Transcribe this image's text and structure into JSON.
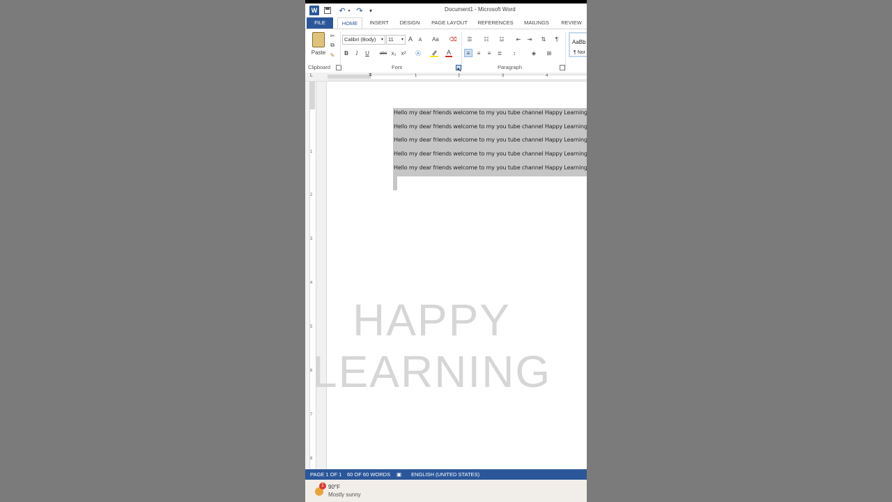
{
  "window": {
    "title": "Document1 - Microsoft Word"
  },
  "quick_access": {
    "app_icon": "W",
    "icons": [
      "word-icon",
      "save-icon",
      "undo-icon",
      "redo-icon",
      "customize-icon"
    ]
  },
  "tabs": [
    "FILE",
    "HOME",
    "INSERT",
    "DESIGN",
    "PAGE LAYOUT",
    "REFERENCES",
    "MAILINGS",
    "REVIEW"
  ],
  "ribbon": {
    "clipboard": {
      "paste_label": "Paste",
      "group_label": "Clipboard"
    },
    "font": {
      "font_name": "Calibri (Body)",
      "font_size": "11",
      "case_label": "Aa",
      "group_label": "Font",
      "bold": "B",
      "italic": "I",
      "underline": "U",
      "strikethrough": "abc",
      "subscript": "x₂",
      "superscript": "x²",
      "grow": "A",
      "shrink": "A",
      "font_color_letter": "A"
    },
    "paragraph": {
      "group_label": "Paragraph",
      "pilcrow": "¶"
    },
    "styles": {
      "preview": "AaBb",
      "normal": "¶ Nor"
    }
  },
  "ruler": {
    "marks": [
      "1",
      "2",
      "3",
      "4"
    ]
  },
  "vruler": {
    "marks": [
      "1",
      "2",
      "3",
      "4",
      "5",
      "6",
      "7",
      "8"
    ]
  },
  "document": {
    "lines": [
      "Hello my dear friends welcome to my you tube channel Happy Learning",
      "Hello my dear friends welcome to my you tube channel Happy Learning",
      "Hello my dear friends welcome to my you tube channel Happy Learning",
      "Hello my dear friends welcome to my you tube channel Happy Learning",
      "Hello my dear friends welcome to my you tube channel Happy Learning"
    ],
    "watermark_line1": "HAPPY",
    "watermark_line2": "LEARNING"
  },
  "status": {
    "page": "PAGE 1 OF 1",
    "words": "60 OF 60 WORDS",
    "language": "ENGLISH (UNITED STATES)"
  },
  "taskbar": {
    "badge": "1",
    "temp": "90°F",
    "condition": "Mostly sunny"
  },
  "colors": {
    "accent": "#2b579a",
    "selection": "#c6c6c6"
  }
}
